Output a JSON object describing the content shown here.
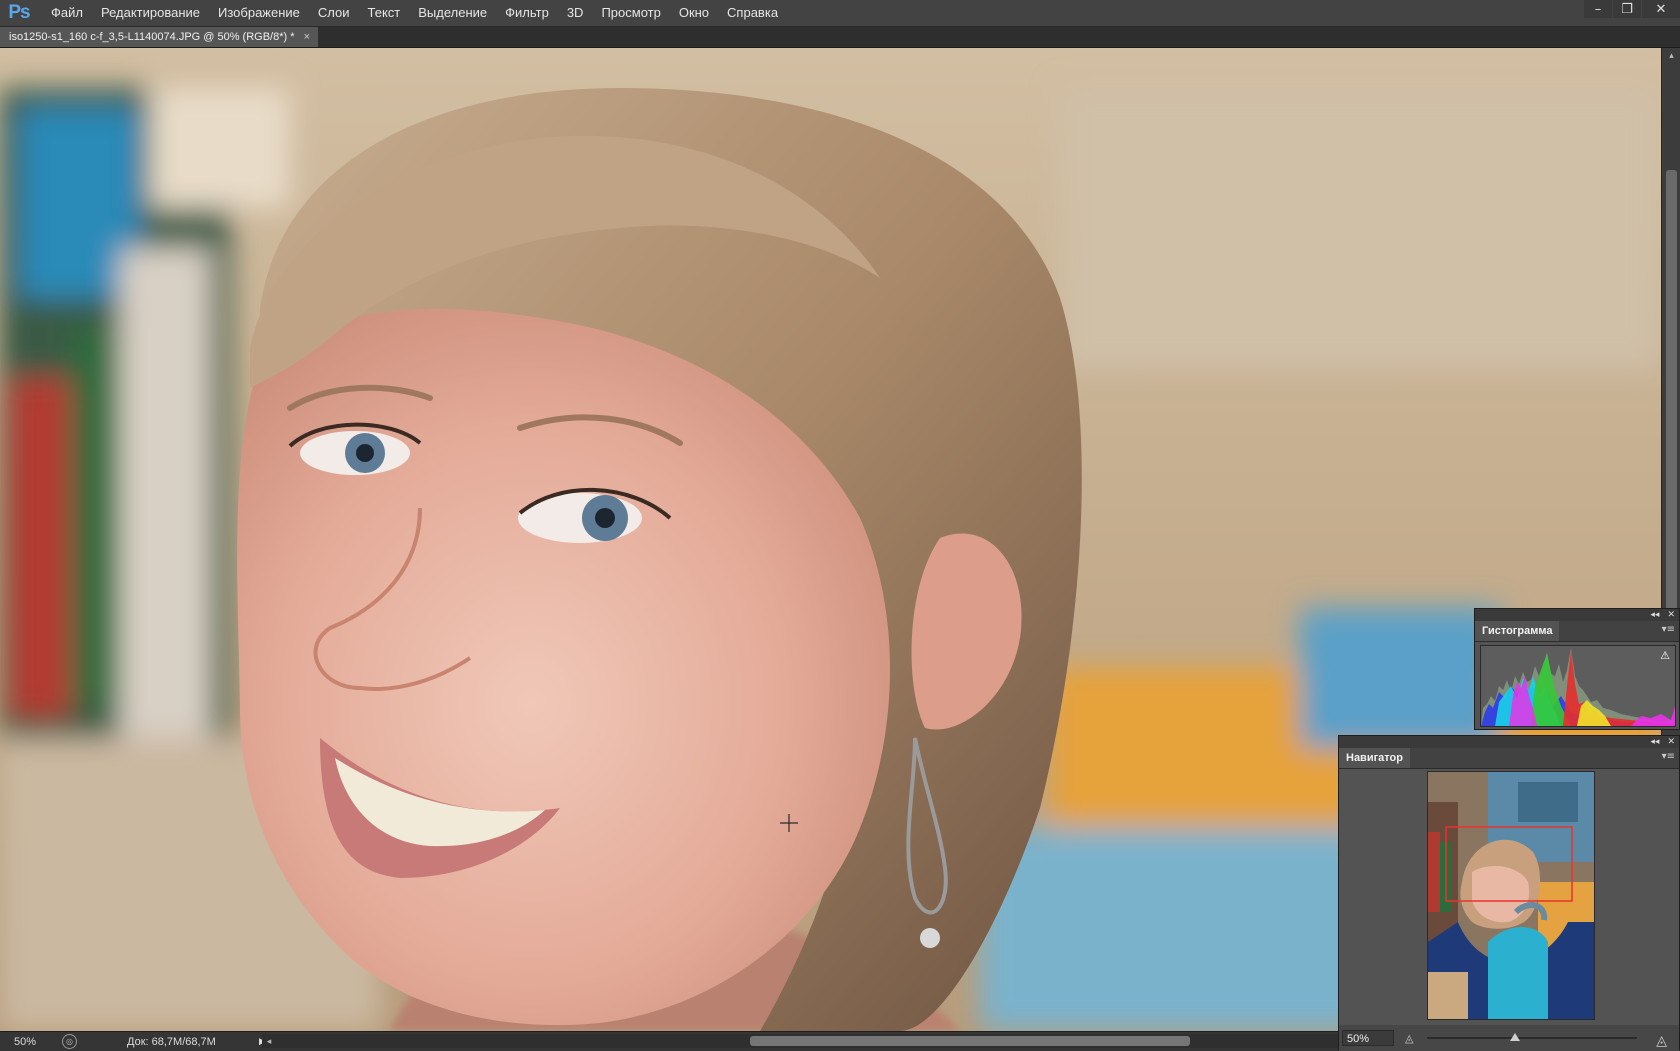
{
  "app": {
    "logo": "Ps",
    "menu": [
      "Файл",
      "Редактирование",
      "Изображение",
      "Слои",
      "Текст",
      "Выделение",
      "Фильтр",
      "3D",
      "Просмотр",
      "Окно",
      "Справка"
    ],
    "window_controls": {
      "minimize": "–",
      "restore": "❐",
      "close": "✕"
    }
  },
  "document": {
    "tab_title": "iso1250-s1_160 c-f_3,5-L1140074.JPG @ 50% (RGB/8*) *",
    "tab_close": "×"
  },
  "status": {
    "zoom": "50%",
    "doc_info": "Док: 68,7M/68,7M",
    "arrow": "▶",
    "scroll_left": "◂"
  },
  "scrollbar": {
    "up": "▴",
    "down": "▾"
  },
  "panels": {
    "histogram": {
      "title": "Гистограмма",
      "warning": "⚠",
      "collapse": "◂◂",
      "close": "✕",
      "menu": "▾≡"
    },
    "navigator": {
      "title": "Навигатор",
      "zoom": "50%",
      "collapse": "◂◂",
      "close": "✕",
      "menu": "▾≡",
      "zoom_out": "◬",
      "zoom_in": "◬",
      "zoom_level": 0.42
    }
  },
  "colors": {
    "accent": "#5aa6e8",
    "nav_view_box": "#e8332e"
  }
}
